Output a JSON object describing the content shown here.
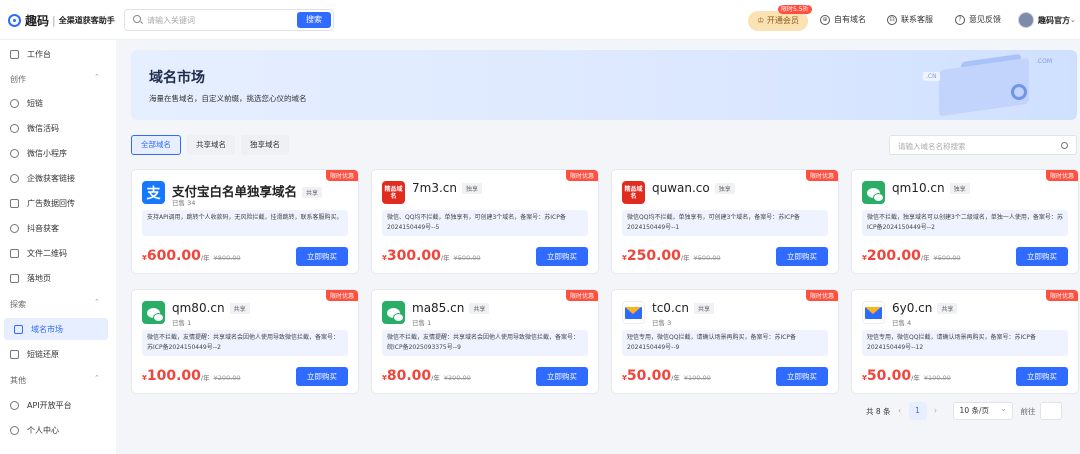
{
  "header": {
    "logo_text": "趣码",
    "logo_sep": "|",
    "logo_sub": "全渠道获客助手",
    "search_placeholder": "请输入关键词",
    "search_button": "搜索",
    "vip_label": "开通会员",
    "vip_badge": "限时5.5折",
    "nav": [
      "自有域名",
      "联系客服",
      "意见反馈"
    ],
    "user_name": "趣码官方"
  },
  "sidebar": {
    "items_top": [
      {
        "label": "工作台"
      }
    ],
    "group_create": "创作",
    "items_create": [
      {
        "label": "短链"
      },
      {
        "label": "微信活码"
      },
      {
        "label": "微信小程序"
      },
      {
        "label": "企微获客链接"
      },
      {
        "label": "广告数据回传"
      },
      {
        "label": "抖音获客"
      },
      {
        "label": "文件二维码"
      },
      {
        "label": "落地页"
      }
    ],
    "group_explore": "探索",
    "items_explore": [
      {
        "label": "域名市场"
      },
      {
        "label": "短链还原"
      }
    ],
    "group_other": "其他",
    "items_other": [
      {
        "label": "API开放平台"
      },
      {
        "label": "个人中心"
      }
    ]
  },
  "banner": {
    "title": "域名市场",
    "subtitle": "海量在售域名，自定义前缀，挑选您心仪的域名",
    "deco_com": ".COM",
    "deco_cn": ".CN"
  },
  "tabs": [
    "全部域名",
    "共享域名",
    "独享域名"
  ],
  "domain_search_placeholder": "请输入域名名称搜索",
  "promo_label": "限时优惠",
  "buy_label": "立即购买",
  "price_unit": "/年",
  "yen": "¥",
  "cards": [
    {
      "name": "支付宝白名单独享域名",
      "tag": "共享",
      "sold": "已售 34",
      "desc": "支持API调用，跳转个人收款码，无风险拦截，挂滑跳转，联系客服购买。",
      "price": "600.00",
      "orig": "¥800.00",
      "icon": "alipay",
      "icon_text": "支"
    },
    {
      "name": "7m3.cn",
      "tag": "独享",
      "sold": "",
      "desc": "微信、QQ均不拦截，单独享有，可创建3个域名，备案号：苏ICP备2024150449号--5",
      "price": "300.00",
      "orig": "¥500.00",
      "icon": "brand",
      "icon_text": "精品域名"
    },
    {
      "name": "quwan.co",
      "tag": "独享",
      "sold": "",
      "desc": "微信QQ均不拦截，单独享有，可创建3个域名，备案号：苏ICP备2024150449号--1",
      "price": "250.00",
      "orig": "¥500.00",
      "icon": "brand",
      "icon_text": "精品域名"
    },
    {
      "name": "qm10.cn",
      "tag": "独享",
      "sold": "",
      "desc": "微信不拦截，独享域名可以创建3个二级域名，单独一人使用，备案号：苏ICP备2024150449号--2",
      "price": "200.00",
      "orig": "¥500.00",
      "icon": "wechat",
      "icon_text": ""
    },
    {
      "name": "qm80.cn",
      "tag": "共享",
      "sold": "已售 1",
      "desc": "微信不拦截，友情提醒：共享域名会因他人使用导致微信拦截，备案号：苏ICP备2024150449号--2",
      "price": "100.00",
      "orig": "¥200.00",
      "icon": "wechat",
      "icon_text": ""
    },
    {
      "name": "ma85.cn",
      "tag": "共享",
      "sold": "已售 1",
      "desc": "微信不拦截，友情提醒：共享域名会因他人使用导致微信拦截，备案号：皖ICP备2025093375号--9",
      "price": "80.00",
      "orig": "¥300.00",
      "icon": "wechat",
      "icon_text": ""
    },
    {
      "name": "tc0.cn",
      "tag": "共享",
      "sold": "已售 3",
      "desc": "短信专用，微信QQ拦截，请确认场景再购买，备案号：苏ICP备2024150449号--9",
      "price": "50.00",
      "orig": "¥100.00",
      "icon": "mail",
      "icon_text": ""
    },
    {
      "name": "6y0.cn",
      "tag": "共享",
      "sold": "已售 4",
      "desc": "短信专用，微信QQ拦截，请确认场景再购买，备案号：苏ICP备2024150449号--12",
      "price": "50.00",
      "orig": "¥100.00",
      "icon": "mail",
      "icon_text": ""
    }
  ],
  "pagination": {
    "total": "共 8 条",
    "prev": "‹",
    "current": "1",
    "next": "›",
    "page_size": "10 条/页",
    "goto": "前往"
  }
}
